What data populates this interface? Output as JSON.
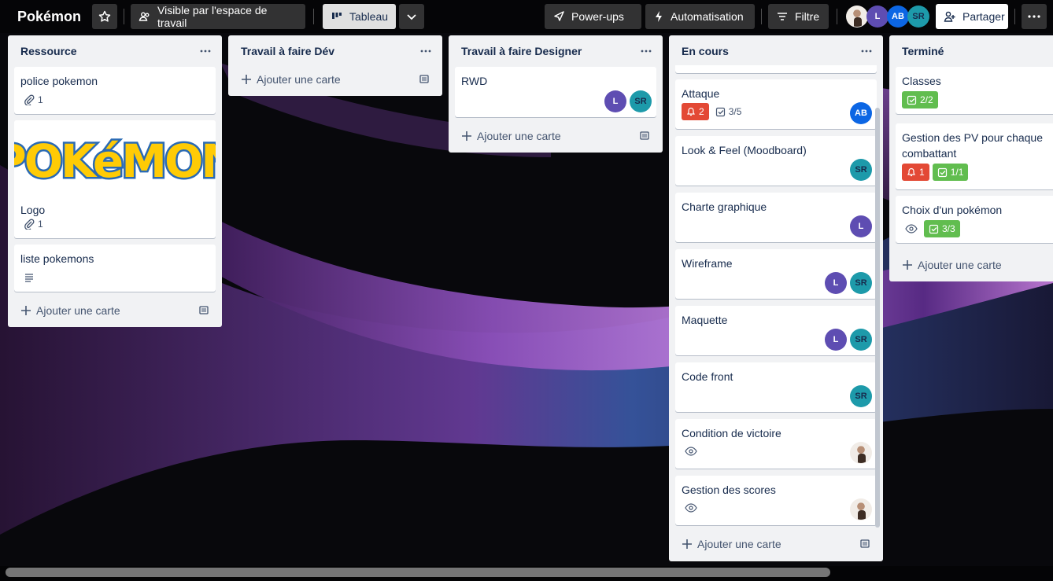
{
  "header": {
    "board_title": "Pokémon",
    "visibility_label": "Visible par l'espace de travail",
    "view_label": "Tableau",
    "powerups_label": "Power-ups",
    "automation_label": "Automatisation",
    "filter_label": "Filtre",
    "share_label": "Partager",
    "members": [
      "L",
      "AB",
      "SR"
    ]
  },
  "lists": [
    {
      "title": "Ressource",
      "cards": [
        {
          "title": "police pokemon",
          "attachments": "1"
        },
        {
          "title": "Logo",
          "attachments": "1",
          "cover_text": "POKéMON"
        },
        {
          "title": "liste pokemons"
        }
      ],
      "add_label": "Ajouter une carte"
    },
    {
      "title": "Travail à faire Dév",
      "cards": [],
      "add_label": "Ajouter une carte"
    },
    {
      "title": "Travail à faire Designer",
      "cards": [
        {
          "title": "RWD",
          "members": [
            "L",
            "SR"
          ]
        }
      ],
      "add_label": "Ajouter une carte"
    },
    {
      "title": "En cours",
      "cards": [
        {
          "title": "Attaque",
          "notifications": "2",
          "checklist": "3/5",
          "members": [
            "AB"
          ]
        },
        {
          "title": "Look & Feel (Moodboard)",
          "members": [
            "SR"
          ]
        },
        {
          "title": "Charte graphique",
          "members": [
            "L"
          ]
        },
        {
          "title": "Wireframe",
          "members": [
            "L",
            "SR"
          ]
        },
        {
          "title": "Maquette",
          "members": [
            "L",
            "SR"
          ]
        },
        {
          "title": "Code front",
          "members": [
            "SR"
          ]
        },
        {
          "title": "Condition de victoire",
          "watching": true
        },
        {
          "title": "Gestion des scores",
          "watching": true
        }
      ],
      "add_label": "Ajouter une carte"
    },
    {
      "title": "Terminé",
      "cards": [
        {
          "title": "Classes",
          "checklist": "2/2"
        },
        {
          "title": "Gestion des PV pour chaque combattant",
          "notifications": "1",
          "checklist": "1/1"
        },
        {
          "title": "Choix d'un pokémon",
          "watching": true,
          "checklist": "3/3"
        }
      ],
      "add_label": "Ajouter une carte"
    }
  ],
  "colors": {
    "accent_red": "#e34935",
    "accent_green": "#61bd4f",
    "member_L": "#5e4db2",
    "member_AB": "#0c66e4",
    "member_SR": "#1d9aaa"
  }
}
